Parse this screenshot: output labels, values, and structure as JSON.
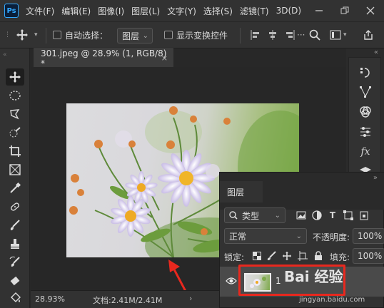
{
  "app": {
    "logo": "Ps"
  },
  "menu": [
    "文件(F)",
    "编辑(E)",
    "图像(I)",
    "图层(L)",
    "文字(Y)",
    "选择(S)",
    "滤镜(T)",
    "3D(D)"
  ],
  "options_bar": {
    "auto_select_label": "自动选择：",
    "auto_select_target": "图层",
    "show_transform_label": "显示变换控件"
  },
  "document": {
    "tab_title": "301.jpeg @ 28.9% (1, RGB/8) *",
    "close_glyph": "×"
  },
  "status": {
    "zoom": "28.93%",
    "doc_size": "文档:2.41M/2.41M"
  },
  "layers_panel": {
    "tab_label": "图层",
    "filter_kind": "类型",
    "blend_mode": "正常",
    "opacity_label": "不透明度:",
    "opacity_value": "100%",
    "lock_label": "锁定:",
    "fill_label": "填充:",
    "fill_value": "100%",
    "layers": [
      {
        "name": "1",
        "visible": true,
        "selected": true
      }
    ]
  },
  "watermark": {
    "logo": "Bai 经验",
    "url": "jingyan.baidu.com"
  },
  "colors": {
    "accent": "#31a8ff",
    "highlight": "#e8281e",
    "panel": "#323232",
    "canvas_bg": "#272727"
  }
}
